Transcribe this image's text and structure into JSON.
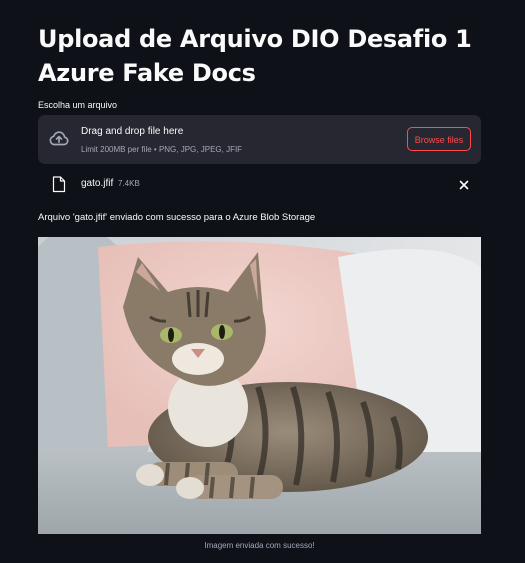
{
  "page": {
    "title": "Upload de Arquivo DIO Desafio 1 Azure Fake Docs"
  },
  "uploader": {
    "label": "Escolha um arquivo",
    "drop_title": "Drag and drop file here",
    "drop_subtitle": "Limit 200MB per file • PNG, JPG, JPEG, JFIF",
    "browse_label": "Browse files",
    "icon": "cloud-upload-icon"
  },
  "uploaded_file": {
    "name": "gato.jfif",
    "size": "7.4KB",
    "icon": "file-icon",
    "remove_icon": "close-icon"
  },
  "status": {
    "message": "Arquivo 'gato.jfif' enviado com sucesso para o Azure Blob Storage"
  },
  "image": {
    "caption": "Imagem enviada com sucesso!"
  },
  "colors": {
    "background": "#0e1117",
    "surface": "#262730",
    "accent": "#ff4b4b",
    "muted_text": "#a3a8b8"
  }
}
